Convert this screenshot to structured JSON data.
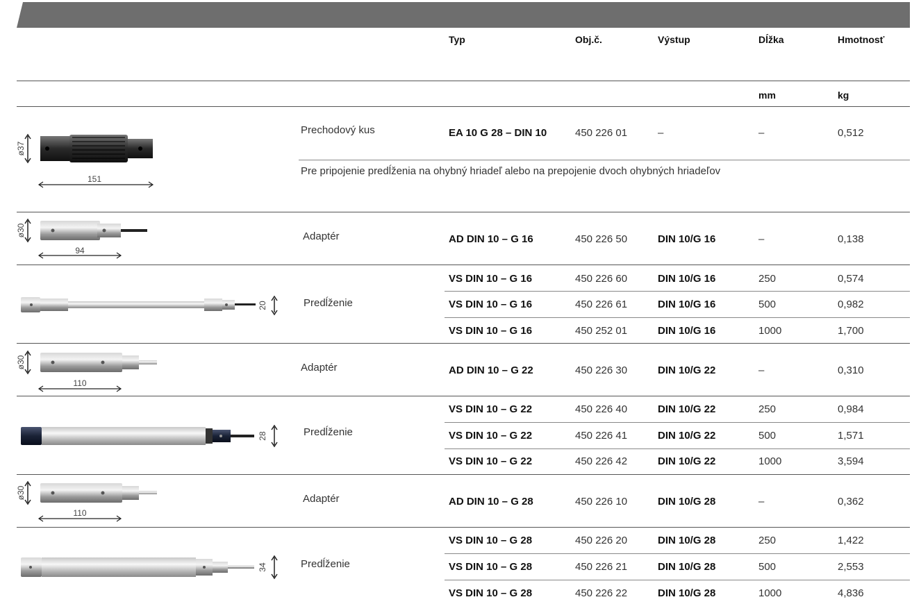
{
  "header": {
    "columns": [
      "Typ",
      "Obj.č.",
      "Výstup",
      "Dĺžka",
      "Hmotnosť"
    ],
    "units": {
      "length": "mm",
      "weight": "kg"
    }
  },
  "groups": [
    {
      "name": "Prechodový kus",
      "image_labels": [
        "ø37",
        "151"
      ],
      "rows": [
        {
          "typ": "EA 10 G 28 – DIN 10",
          "objc": "450 226 01",
          "vystup": "–",
          "dlzka": "–",
          "hmotnost": "0,512"
        }
      ],
      "note": "Pre pripojenie predĺženia na ohybný hriadeľ alebo na prepojenie dvoch ohybných hriadeľov"
    },
    {
      "name": "Adaptér",
      "image_labels": [
        "ø30",
        "94"
      ],
      "rows": [
        {
          "typ": "AD DIN 10 – G 16",
          "objc": "450 226 50",
          "vystup": "DIN 10/G 16",
          "dlzka": "–",
          "hmotnost": "0,138"
        }
      ]
    },
    {
      "name": "Predĺženie",
      "image_labels": [
        "20"
      ],
      "rows": [
        {
          "typ": "VS DIN 10 – G 16",
          "objc": "450 226 60",
          "vystup": "DIN 10/G 16",
          "dlzka": "250",
          "hmotnost": "0,574"
        },
        {
          "typ": "VS DIN 10 – G 16",
          "objc": "450 226 61",
          "vystup": "DIN 10/G 16",
          "dlzka": "500",
          "hmotnost": "0,982"
        },
        {
          "typ": "VS DIN 10 – G 16",
          "objc": "450 252 01",
          "vystup": "DIN 10/G 16",
          "dlzka": "1000",
          "hmotnost": "1,700"
        }
      ]
    },
    {
      "name": "Adaptér",
      "image_labels": [
        "ø30",
        "110"
      ],
      "rows": [
        {
          "typ": "AD DIN 10 – G 22",
          "objc": "450 226 30",
          "vystup": "DIN 10/G 22",
          "dlzka": "–",
          "hmotnost": "0,310"
        }
      ]
    },
    {
      "name": "Predĺženie",
      "image_labels": [
        "28"
      ],
      "rows": [
        {
          "typ": "VS DIN 10 – G 22",
          "objc": "450 226 40",
          "vystup": "DIN 10/G 22",
          "dlzka": "250",
          "hmotnost": "0,984"
        },
        {
          "typ": "VS DIN 10 – G 22",
          "objc": "450 226 41",
          "vystup": "DIN 10/G 22",
          "dlzka": "500",
          "hmotnost": "1,571"
        },
        {
          "typ": "VS DIN 10 – G 22",
          "objc": "450 226 42",
          "vystup": "DIN 10/G 22",
          "dlzka": "1000",
          "hmotnost": "3,594"
        }
      ]
    },
    {
      "name": "Adaptér",
      "image_labels": [
        "ø30",
        "110"
      ],
      "rows": [
        {
          "typ": "AD DIN 10 – G 28",
          "objc": "450 226 10",
          "vystup": "DIN 10/G 28",
          "dlzka": "–",
          "hmotnost": "0,362"
        }
      ]
    },
    {
      "name": "Predĺženie",
      "image_labels": [
        "34"
      ],
      "rows": [
        {
          "typ": "VS DIN 10 – G 28",
          "objc": "450 226 20",
          "vystup": "DIN 10/G 28",
          "dlzka": "250",
          "hmotnost": "1,422"
        },
        {
          "typ": "VS DIN 10 – G 28",
          "objc": "450 226 21",
          "vystup": "DIN 10/G 28",
          "dlzka": "500",
          "hmotnost": "2,553"
        },
        {
          "typ": "VS DIN 10 – G 28",
          "objc": "450 226 22",
          "vystup": "DIN 10/G 28",
          "dlzka": "1000",
          "hmotnost": "4,836"
        }
      ]
    }
  ]
}
